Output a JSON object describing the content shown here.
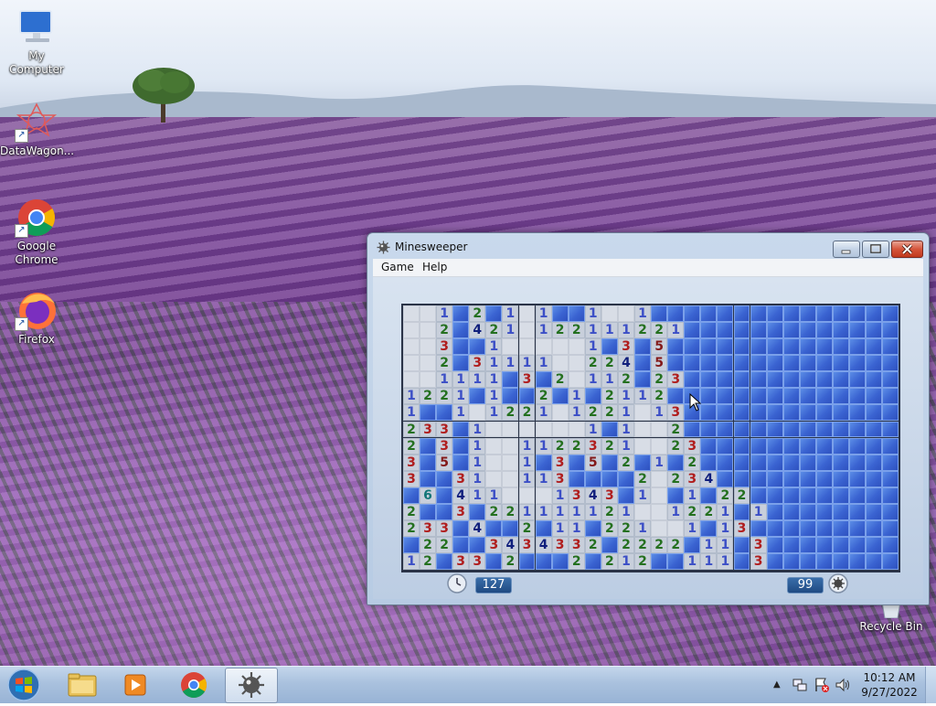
{
  "desktop": {
    "icons": [
      {
        "label": "My Computer"
      },
      {
        "label": "DataWagon..."
      },
      {
        "label": "Google Chrome"
      },
      {
        "label": "Firefox"
      },
      {
        "label": "Recycle Bin"
      }
    ]
  },
  "window": {
    "title": "Minesweeper",
    "menu": [
      "Game",
      "Help"
    ],
    "timer": "127",
    "mines_left": "99",
    "grid": {
      "legend": "c=covered, e=empty revealed, digit=revealed number",
      "rows": [
        "ee1c2c1e1cc1ee1ccccccccccccccc",
        "ee2c421e122111221ccccccccccccc",
        "ee3cc1eeeee1c3c5cccccccccccccc",
        "ee2c31111ee224c5cccccccccccccc",
        "ee1111c3c2e112c23ccccccccccccc",
        "1221c1cc2c1c2112cccccccccccccc",
        "1cc1e1221e1221e13ccccccccccccc",
        "233c1eeeeee1c1ee2ccccccccccccc",
        "2c3c1ee1122321ee23cccccccccccc",
        "3c5c1ee1c3c5c2c1c2cccccccccccc",
        "3cc31ee113cccc2e234ccccccccccc",
        "c6c411eee1343c1ec1c22ccccccccc",
        "2cc3c221111121ee1221c1cccccccc",
        "233c4cc2c11c221ee1c13ccccccccc",
        "c22cc3434332c2222c11c3cccccccc",
        "12c33c2ccc2c212cc111c3cccccccc"
      ]
    }
  },
  "taskbar": {
    "apps": [
      "Windows Explorer",
      "Windows Media Player",
      "Google Chrome",
      "Minesweeper"
    ],
    "active_app": "Minesweeper",
    "time": "10:12 AM",
    "date": "9/27/2022"
  }
}
